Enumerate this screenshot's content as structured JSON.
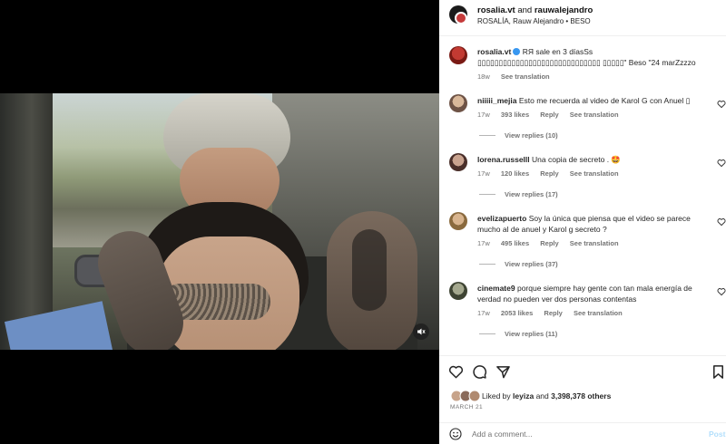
{
  "header": {
    "user1": "rosalia.vt",
    "and": "and",
    "user2": "rauwalejandro",
    "subtitle": "ROSALÍA, Rauw Alejandro • BESO"
  },
  "caption": {
    "user": "rosalia.vt",
    "text": "RЯ sale en 3 díasSs ▯▯▯▯▯▯▯▯▯▯▯▯▯▯▯▯▯▯▯▯▯▯▯▯▯▯▯▯▯ ▯▯▯▯▯\" Beso \"24 marZzzzo",
    "age": "18w",
    "translate": "See translation"
  },
  "comments": [
    {
      "user": "niiiii_mejia",
      "text": "Esto me recuerda al video de Karol G con Anuel ▯",
      "age": "17w",
      "likes": "393 likes",
      "reply": "Reply",
      "translate": "See translation",
      "replies": "View replies (10)"
    },
    {
      "user": "lorena.russelll",
      "text": "Una copia de secreto . 🤩",
      "age": "17w",
      "likes": "120 likes",
      "reply": "Reply",
      "translate": "See translation",
      "replies": "View replies (17)"
    },
    {
      "user": "evelizapuerto",
      "text": "Soy la única que piensa que el video se parece mucho al de anuel y Karol g secreto ?",
      "age": "17w",
      "likes": "495 likes",
      "reply": "Reply",
      "translate": "See translation",
      "replies": "View replies (37)"
    },
    {
      "user": "cinemate9",
      "text": "porque siempre hay gente con tan mala energía de verdad no pueden ver dos personas contentas",
      "age": "17w",
      "likes": "2053 likes",
      "reply": "Reply",
      "translate": "See translation",
      "replies": "View replies (11)"
    }
  ],
  "likes": {
    "prefix": "Liked by",
    "user": "leyiza",
    "and": "and",
    "count": "3,398,378 others"
  },
  "date": "MARCH 21",
  "composer": {
    "placeholder": "Add a comment...",
    "post": "Post"
  },
  "icons": {
    "like": "heart-icon",
    "comment": "comment-icon",
    "share": "send-icon",
    "save": "bookmark-icon",
    "emoji": "smile-icon",
    "mute": "volume-muted-icon"
  },
  "colors": {
    "verified": "#3897f0",
    "post_button": "#b2dffc"
  }
}
